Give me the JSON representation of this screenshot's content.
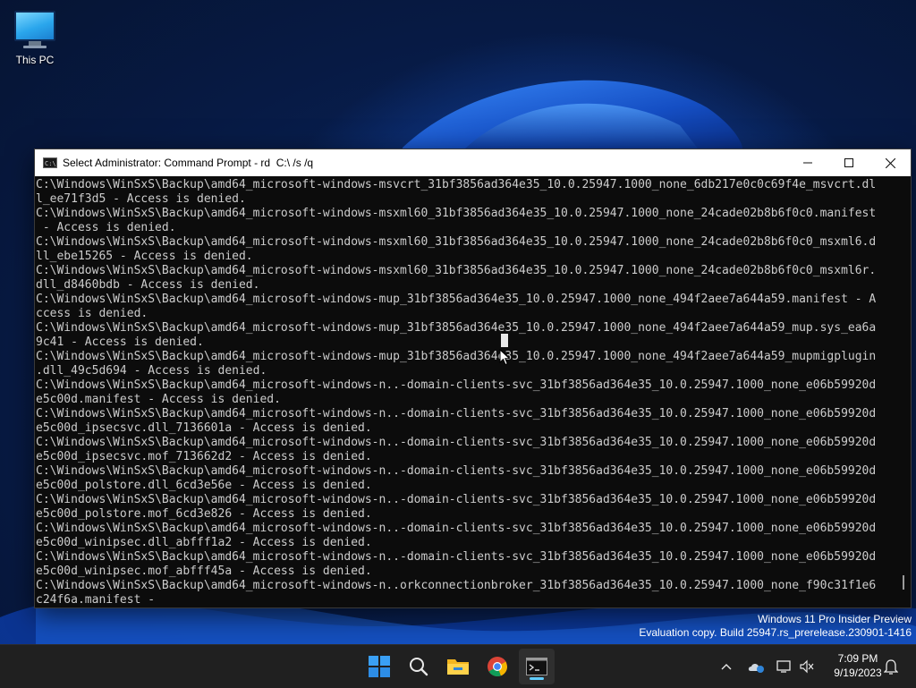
{
  "desktop": {
    "icons": [
      {
        "label": "This PC",
        "icon": "monitor-icon"
      }
    ]
  },
  "console": {
    "title": "Select Administrator: Command Prompt - rd  C:\\ /s /q",
    "controls": {
      "minimize": "minimize-icon",
      "maximize": "maximize-icon",
      "close": "close-icon"
    },
    "lines": [
      "C:\\Windows\\WinSxS\\Backup\\amd64_microsoft-windows-msvcrt_31bf3856ad364e35_10.0.25947.1000_none_6db217e0c0c69f4e_msvcrt.dl",
      "l_ee71f3d5 - Access is denied.",
      "C:\\Windows\\WinSxS\\Backup\\amd64_microsoft-windows-msxml60_31bf3856ad364e35_10.0.25947.1000_none_24cade02b8b6f0c0.manifest",
      " - Access is denied.",
      "C:\\Windows\\WinSxS\\Backup\\amd64_microsoft-windows-msxml60_31bf3856ad364e35_10.0.25947.1000_none_24cade02b8b6f0c0_msxml6.d",
      "ll_ebe15265 - Access is denied.",
      "C:\\Windows\\WinSxS\\Backup\\amd64_microsoft-windows-msxml60_31bf3856ad364e35_10.0.25947.1000_none_24cade02b8b6f0c0_msxml6r.",
      "dll_d8460bdb - Access is denied.",
      "C:\\Windows\\WinSxS\\Backup\\amd64_microsoft-windows-mup_31bf3856ad364e35_10.0.25947.1000_none_494f2aee7a644a59.manifest - A",
      "ccess is denied.",
      "C:\\Windows\\WinSxS\\Backup\\amd64_microsoft-windows-mup_31bf3856ad364e35_10.0.25947.1000_none_494f2aee7a644a59_mup.sys_ea6a",
      "9c41 - Access is denied.",
      "C:\\Windows\\WinSxS\\Backup\\amd64_microsoft-windows-mup_31bf3856ad364e35_10.0.25947.1000_none_494f2aee7a644a59_mupmigplugin",
      ".dll_49c5d694 - Access is denied.",
      "C:\\Windows\\WinSxS\\Backup\\amd64_microsoft-windows-n..-domain-clients-svc_31bf3856ad364e35_10.0.25947.1000_none_e06b59920d",
      "e5c00d.manifest - Access is denied.",
      "C:\\Windows\\WinSxS\\Backup\\amd64_microsoft-windows-n..-domain-clients-svc_31bf3856ad364e35_10.0.25947.1000_none_e06b59920d",
      "e5c00d_ipsecsvc.dll_7136601a - Access is denied.",
      "C:\\Windows\\WinSxS\\Backup\\amd64_microsoft-windows-n..-domain-clients-svc_31bf3856ad364e35_10.0.25947.1000_none_e06b59920d",
      "e5c00d_ipsecsvc.mof_713662d2 - Access is denied.",
      "C:\\Windows\\WinSxS\\Backup\\amd64_microsoft-windows-n..-domain-clients-svc_31bf3856ad364e35_10.0.25947.1000_none_e06b59920d",
      "e5c00d_polstore.dll_6cd3e56e - Access is denied.",
      "C:\\Windows\\WinSxS\\Backup\\amd64_microsoft-windows-n..-domain-clients-svc_31bf3856ad364e35_10.0.25947.1000_none_e06b59920d",
      "e5c00d_polstore.mof_6cd3e826 - Access is denied.",
      "C:\\Windows\\WinSxS\\Backup\\amd64_microsoft-windows-n..-domain-clients-svc_31bf3856ad364e35_10.0.25947.1000_none_e06b59920d",
      "e5c00d_winipsec.dll_abfff1a2 - Access is denied.",
      "C:\\Windows\\WinSxS\\Backup\\amd64_microsoft-windows-n..-domain-clients-svc_31bf3856ad364e35_10.0.25947.1000_none_e06b59920d",
      "e5c00d_winipsec.mof_abfff45a - Access is denied.",
      "C:\\Windows\\WinSxS\\Backup\\amd64_microsoft-windows-n..orkconnectionbroker_31bf3856ad364e35_10.0.25947.1000_none_f90c31f1e6",
      "c24f6a.manifest -"
    ]
  },
  "watermark": {
    "line1": "Windows 11 Pro Insider Preview",
    "line2": "Evaluation copy. Build 25947.rs_prerelease.230901-1416"
  },
  "taskbar": {
    "apps": [
      "start-icon",
      "search-icon",
      "file-explorer-icon",
      "chrome-icon",
      "command-prompt-icon"
    ],
    "tray": [
      "chevron-up-icon",
      "onedrive-icon",
      "network-icon",
      "volume-muted-icon",
      "notification-bell-icon"
    ],
    "accent": "#60cdff"
  },
  "clock": {
    "time": "7:09 PM",
    "date": "9/19/2023"
  }
}
